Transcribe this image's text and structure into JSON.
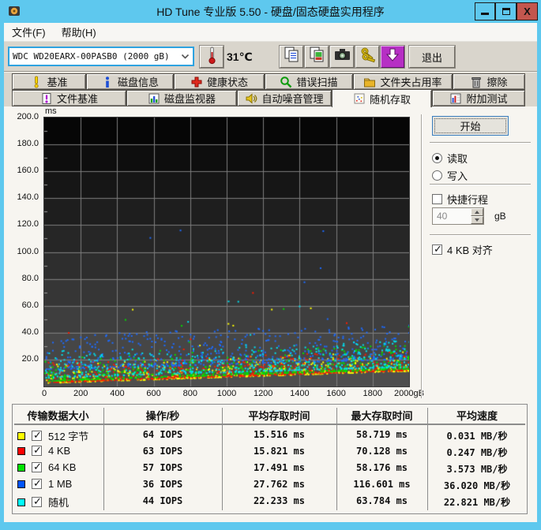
{
  "window": {
    "title": "HD Tune 专业版 5.50 - 硬盘/固态硬盘实用程序",
    "app_icon": "hard-disk-icon",
    "controls": [
      "minimize",
      "maximize",
      "close"
    ],
    "close_glyph": "X"
  },
  "menu": {
    "items": [
      {
        "label": "文件(F)"
      },
      {
        "label": "帮助(H)"
      }
    ]
  },
  "toolbar": {
    "drive_select": {
      "value": "WDC WD20EARX-00PASB0 (2000 gB)",
      "icon": "chevron-down-icon"
    },
    "temperature": {
      "value": "31℃",
      "icon": "thermometer-icon"
    },
    "buttons": [
      {
        "name": "copy-text-button",
        "icon": "copy-text-icon"
      },
      {
        "name": "copy-image-button",
        "icon": "copy-image-icon"
      },
      {
        "name": "screenshot-button",
        "icon": "camera-icon"
      },
      {
        "name": "register-button",
        "icon": "keys-icon"
      },
      {
        "name": "update-button",
        "icon": "download-arrow-icon"
      }
    ],
    "exit_label": "退出"
  },
  "tabs": {
    "row1": [
      {
        "label": "基准",
        "icon": "benchmark-icon",
        "active": false
      },
      {
        "label": "磁盘信息",
        "icon": "disk-info-icon",
        "active": false
      },
      {
        "label": "健康状态",
        "icon": "health-icon",
        "active": false
      },
      {
        "label": "错误扫描",
        "icon": "error-scan-icon",
        "active": false
      },
      {
        "label": "文件夹占用率",
        "icon": "folder-usage-icon",
        "active": false
      },
      {
        "label": "擦除",
        "icon": "erase-icon",
        "active": false
      }
    ],
    "row2": [
      {
        "label": "文件基准",
        "icon": "file-benchmark-icon",
        "active": false
      },
      {
        "label": "磁盘监视器",
        "icon": "disk-monitor-icon",
        "active": false
      },
      {
        "label": "自动噪音管理",
        "icon": "aam-icon",
        "active": false
      },
      {
        "label": "随机存取",
        "icon": "random-access-icon",
        "active": true
      },
      {
        "label": "附加测试",
        "icon": "extra-tests-icon",
        "active": false
      }
    ],
    "active_tab": "随机存取"
  },
  "controls": {
    "start_label": "开始",
    "read_label": "读取",
    "write_label": "写入",
    "mode_selected": "读取",
    "short_stroke_label": "快捷行程",
    "short_stroke_checked": false,
    "short_stroke_value": "40",
    "short_stroke_unit": "gB",
    "align_label": "4 KB 对齐",
    "align_checked": true
  },
  "chart_data": {
    "type": "scatter",
    "title": "随机存取 存取时间 (ms) vs 磁盘位置 (gB)",
    "xlabel": "gB",
    "ylabel": "ms",
    "xlim": [
      0,
      2000
    ],
    "ylim": [
      0,
      200
    ],
    "xticks": [
      0,
      200,
      400,
      600,
      800,
      1000,
      1200,
      1400,
      1600,
      1800,
      2000
    ],
    "x_last_tick_label": "2000gB",
    "yticks": [
      20,
      40,
      60,
      80,
      100,
      120,
      140,
      160,
      180,
      200
    ],
    "ytick_format": "0.0",
    "grid": true,
    "background": "dark-gradient-bands",
    "legend_position": "table-below",
    "series": [
      {
        "name": "512 字节",
        "color": "#ffff00",
        "iops": 64,
        "avg_access_ms": 15.516,
        "max_access_ms": 58.719,
        "avg_speed_mb_s": 0.031,
        "gen": {
          "count": 520,
          "base_start": 3.0,
          "base_end": 12.0,
          "spread": 15,
          "skew": 3.0,
          "outlier_rate": 0.006,
          "seed": 101
        }
      },
      {
        "name": "4 KB",
        "color": "#ff1a00",
        "iops": 63,
        "avg_access_ms": 15.821,
        "max_access_ms": 70.128,
        "avg_speed_mb_s": 0.247,
        "gen": {
          "count": 520,
          "base_start": 3.5,
          "base_end": 12.5,
          "spread": 15,
          "skew": 3.0,
          "outlier_rate": 0.006,
          "seed": 202
        }
      },
      {
        "name": "64 KB",
        "color": "#00dd00",
        "iops": 57,
        "avg_access_ms": 17.491,
        "max_access_ms": 58.176,
        "avg_speed_mb_s": 3.573,
        "gen": {
          "count": 520,
          "base_start": 4.5,
          "base_end": 13.5,
          "spread": 18,
          "skew": 2.8,
          "outlier_rate": 0.008,
          "seed": 303
        }
      },
      {
        "name": "1 MB",
        "color": "#1d6bff",
        "iops": 36,
        "avg_access_ms": 27.762,
        "max_access_ms": 116.601,
        "avg_speed_mb_s": 36.02,
        "gen": {
          "count": 520,
          "base_start": 13.0,
          "base_end": 21.0,
          "spread": 26,
          "skew": 2.2,
          "outlier_rate": 0.01,
          "seed": 404
        }
      },
      {
        "name": "随机",
        "color": "#00e0f0",
        "iops": 44,
        "avg_access_ms": 22.233,
        "max_access_ms": 63.784,
        "avg_speed_mb_s": 22.821,
        "gen": {
          "count": 520,
          "base_start": 7.0,
          "base_end": 15.0,
          "spread": 20,
          "skew": 2.4,
          "outlier_rate": 0.008,
          "seed": 505
        }
      }
    ]
  },
  "table": {
    "headers": [
      "传输数据大小",
      "操作/秒",
      "平均存取时间",
      "最大存取时间",
      "平均速度"
    ],
    "rows": [
      {
        "color": "#ffff00",
        "checked": true,
        "label": "512 字节",
        "ops": "64 IOPS",
        "avg": "15.516 ms",
        "max": "58.719 ms",
        "speed": "0.031 MB/秒"
      },
      {
        "color": "#ff0000",
        "checked": true,
        "label": "4 KB",
        "ops": "63 IOPS",
        "avg": "15.821 ms",
        "max": "70.128 ms",
        "speed": "0.247 MB/秒"
      },
      {
        "color": "#00e400",
        "checked": true,
        "label": "64 KB",
        "ops": "57 IOPS",
        "avg": "17.491 ms",
        "max": "58.176 ms",
        "speed": "3.573 MB/秒"
      },
      {
        "color": "#0055ff",
        "checked": true,
        "label": "1 MB",
        "ops": "36 IOPS",
        "avg": "27.762 ms",
        "max": "116.601 ms",
        "speed": "36.020 MB/秒"
      },
      {
        "color": "#00ffff",
        "checked": true,
        "label": "随机",
        "ops": "44 IOPS",
        "avg": "22.233 ms",
        "max": "63.784 ms",
        "speed": "22.821 MB/秒"
      }
    ]
  }
}
